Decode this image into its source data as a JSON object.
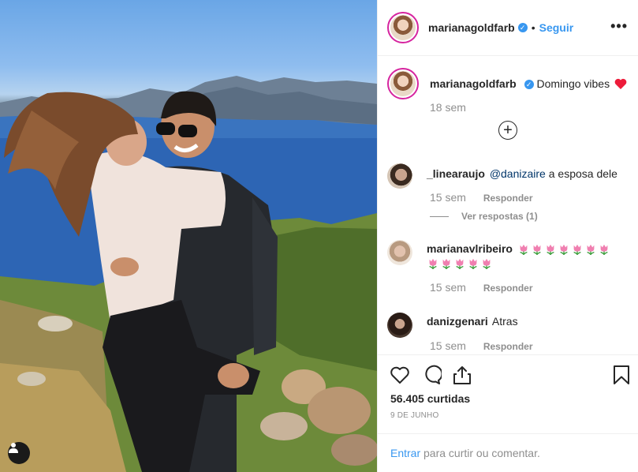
{
  "post": {
    "author": "marianagoldfarb",
    "follow_label": "Seguir",
    "more_label": "•••",
    "dot": "•",
    "caption": {
      "username": "marianagoldfarb",
      "text": "Domingo vibes",
      "time": "18 sem"
    },
    "comments": [
      {
        "username": "_linearaujo",
        "mention": "@danizaire",
        "text": " a esposa dele",
        "time": "15 sem",
        "reply_label": "Responder",
        "view_replies": "Ver respostas (1)"
      },
      {
        "username": "marianavlribeiro",
        "text": "",
        "emoji_count": 12,
        "time": "15 sem",
        "reply_label": "Responder"
      },
      {
        "username": "danizgenari",
        "text": "Atras",
        "time": "15 sem",
        "reply_label": "Responder"
      }
    ],
    "likes": "56.405 curtidas",
    "date": "9 DE JUNHO",
    "footer": {
      "login": "Entrar",
      "rest": " para curtir ou comentar."
    }
  },
  "icons": {
    "heart": "heart-icon",
    "comment": "comment-icon",
    "share": "share-icon",
    "save": "bookmark-icon",
    "tag": "user-tag-icon",
    "load_more": "plus-circle-icon",
    "verified": "verified-badge-icon"
  },
  "colors": {
    "link": "#3897f0",
    "verified": "#3897f0",
    "secondary_text": "#8e8e8e",
    "heart_emoji": "#ed1c3a"
  }
}
